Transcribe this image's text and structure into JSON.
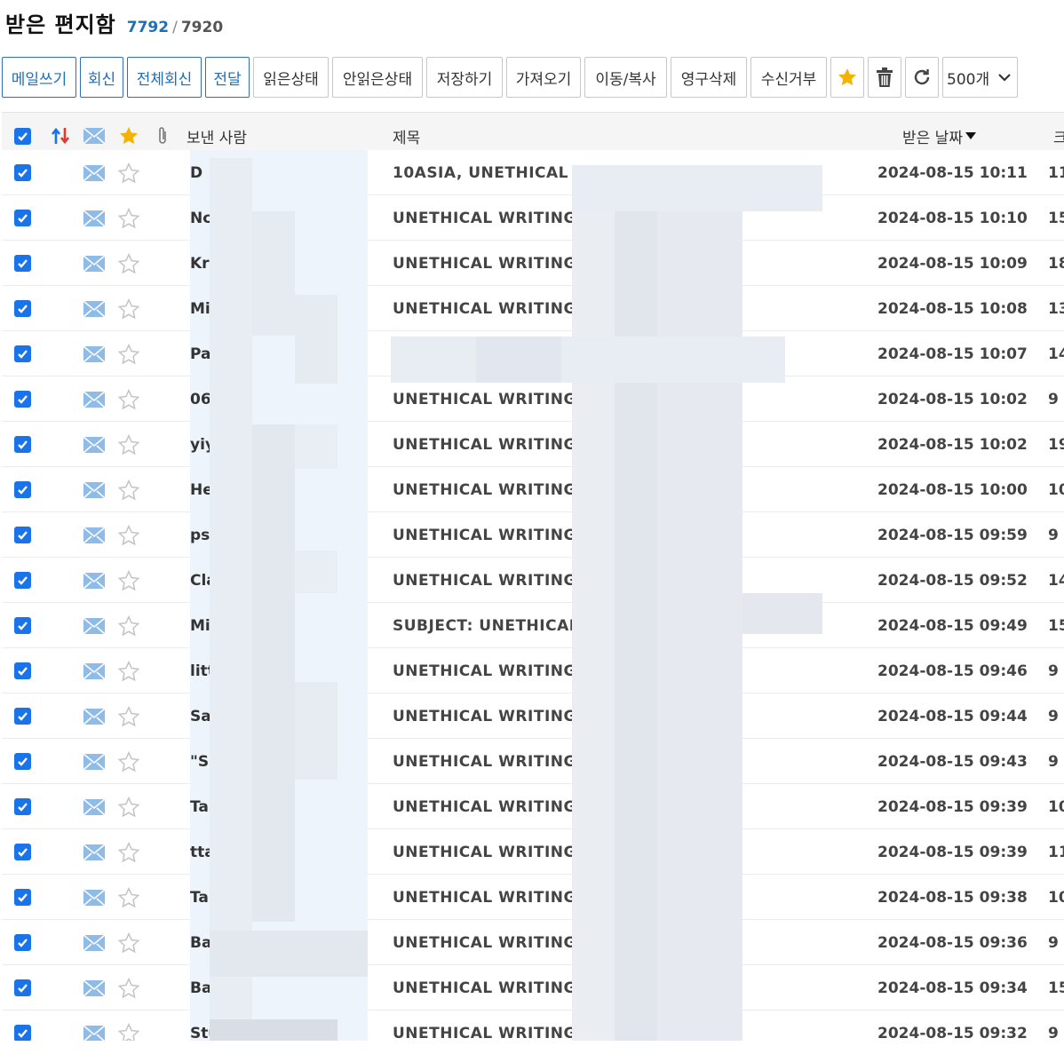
{
  "header": {
    "title": "받은 편지함",
    "unread_count": "7792",
    "separator": "/",
    "total_count": "7920"
  },
  "toolbar": {
    "compose": "메일쓰기",
    "reply": "회신",
    "reply_all": "전체회신",
    "forward": "전달",
    "mark_read": "읽은상태",
    "mark_unread": "안읽은상태",
    "save": "저장하기",
    "import": "가져오기",
    "move_copy": "이동/복사",
    "delete_permanent": "영구삭제",
    "block": "수신거부",
    "page_size": "500개"
  },
  "table": {
    "col_sender": "보낸 사람",
    "col_subject": "제목",
    "col_date": "받은 날짜",
    "col_size": "크",
    "rows": [
      {
        "sender": "D",
        "subject": "10ASIA, UNETHICAL WR",
        "date": "2024-08-15 10:11",
        "size": "11"
      },
      {
        "sender": "Nc",
        "subject": "UNETHICAL WRITINGS",
        "date": "2024-08-15 10:10",
        "size": "15"
      },
      {
        "sender": "Kri",
        "subject": "UNETHICAL WRITINGS",
        "date": "2024-08-15 10:09",
        "size": "18"
      },
      {
        "sender": "Mi",
        "subject": "UNETHICAL WRITINGS",
        "date": "2024-08-15 10:08",
        "size": "13"
      },
      {
        "sender": "Pa",
        "subject": "",
        "date": "2024-08-15 10:07",
        "size": "14"
      },
      {
        "sender": "06",
        "subject": "UNETHICAL WRITINGS",
        "date": "2024-08-15 10:02",
        "size": "9"
      },
      {
        "sender": "yiy",
        "subject": "UNETHICAL WRITINGS",
        "date": "2024-08-15 10:02",
        "size": "19"
      },
      {
        "sender": "He",
        "subject": "UNETHICAL WRITINGS",
        "date": "2024-08-15 10:00",
        "size": "10"
      },
      {
        "sender": "psl",
        "subject": "UNETHICAL WRITINGS",
        "date": "2024-08-15 09:59",
        "size": "9"
      },
      {
        "sender": "Cla",
        "subject": "UNETHICAL WRITINGS",
        "date": "2024-08-15 09:52",
        "size": "14"
      },
      {
        "sender": "Mi",
        "subject": "SUBJECT: UNETHICAL W",
        "date": "2024-08-15 09:49",
        "size": "15"
      },
      {
        "sender": "litt",
        "subject": "UNETHICAL WRITINGS",
        "date": "2024-08-15 09:46",
        "size": "9"
      },
      {
        "sender": "Sa",
        "subject": "UNETHICAL WRITINGS",
        "date": "2024-08-15 09:44",
        "size": "9"
      },
      {
        "sender": "\"S.",
        "subject": "UNETHICAL WRITINGS",
        "date": "2024-08-15 09:43",
        "size": "9"
      },
      {
        "sender": "Tai",
        "subject": "UNETHICAL WRITINGS",
        "date": "2024-08-15 09:39",
        "size": "10"
      },
      {
        "sender": "tta",
        "subject": "UNETHICAL WRITINGS",
        "date": "2024-08-15 09:39",
        "size": "11"
      },
      {
        "sender": "Tai",
        "subject": "UNETHICAL WRITINGS",
        "date": "2024-08-15 09:38",
        "size": "10"
      },
      {
        "sender": "Ba",
        "subject": "UNETHICAL WRITINGS",
        "date": "2024-08-15 09:36",
        "size": "9"
      },
      {
        "sender": "Ba",
        "subject": "UNETHICAL WRITINGS",
        "date": "2024-08-15 09:34",
        "size": "15"
      },
      {
        "sender": "Stu",
        "subject": "UNETHICAL WRITINGS",
        "date": "2024-08-15 09:32",
        "size": "9"
      }
    ]
  },
  "icons": {
    "checkbox": "checkbox-checked-icon",
    "sort": "sort-arrows-icon",
    "envelope": "envelope-icon",
    "star": "star-icon",
    "attachment": "paperclip-icon",
    "trash": "trash-icon",
    "refresh": "refresh-icon",
    "dropdown": "chevron-down-icon"
  },
  "colors": {
    "accent_blue": "#1a73e8",
    "link_blue": "#1f6fb5",
    "star_gold": "#f5b301",
    "envelope_blue": "#8fbbe8"
  }
}
